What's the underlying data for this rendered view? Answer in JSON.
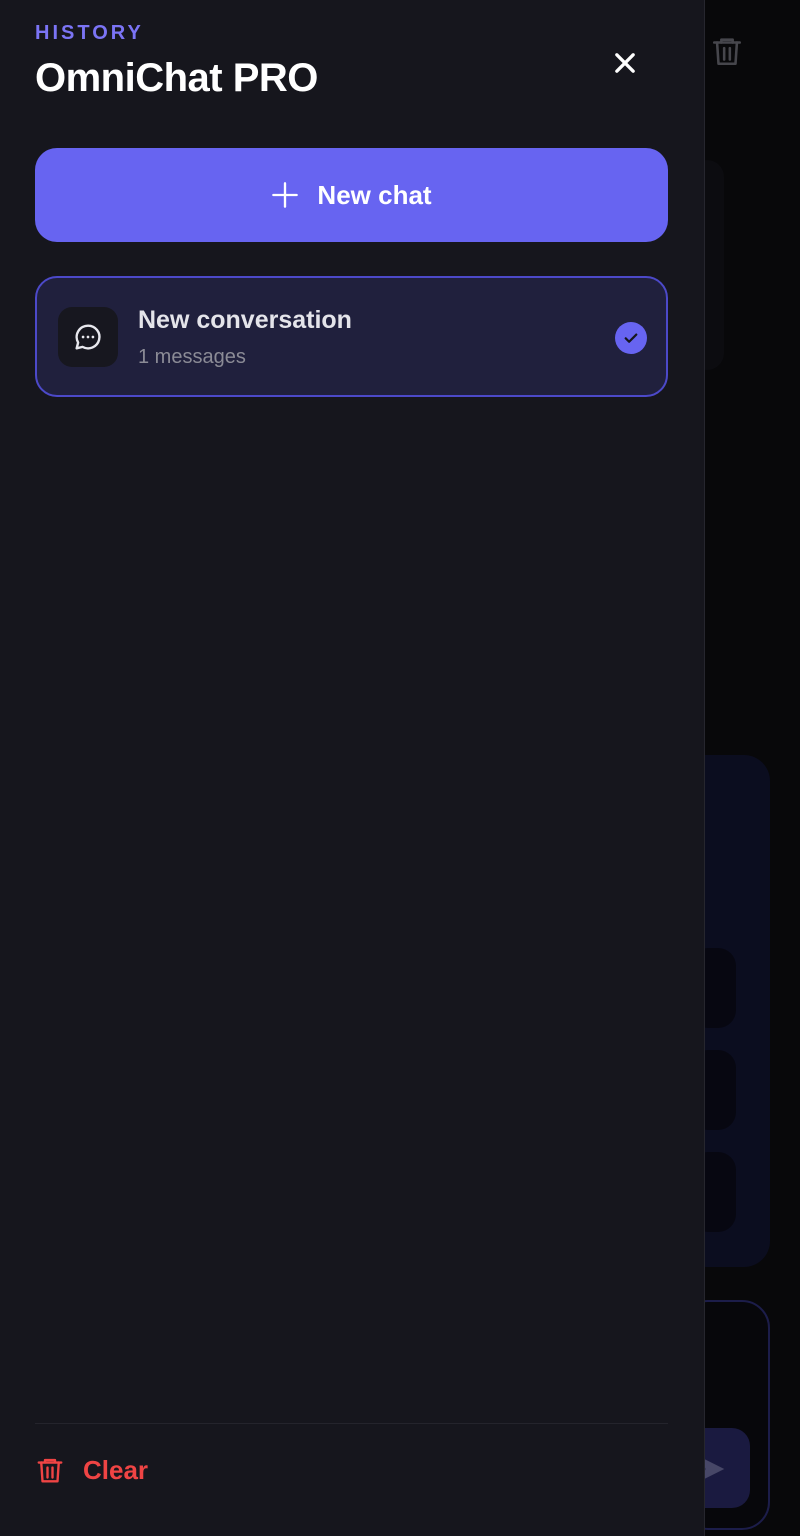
{
  "drawer": {
    "eyebrow": "HISTORY",
    "title": "OmniChat PRO",
    "close_icon": "close-icon",
    "new_chat_label": "New chat",
    "new_chat_icon": "plus-icon",
    "conversations": [
      {
        "title": "New conversation",
        "count_label": "1 messages",
        "icon": "chat-bubble-icon",
        "selected": true
      }
    ],
    "clear_label": "Clear",
    "clear_icon": "trash-icon"
  },
  "colors": {
    "accent": "#6764f1",
    "eyebrow": "#7b74f5",
    "drawer_bg": "#16161d",
    "selected_bg": "#20203d",
    "selected_border": "#4c49c9",
    "danger": "#ef4444"
  }
}
